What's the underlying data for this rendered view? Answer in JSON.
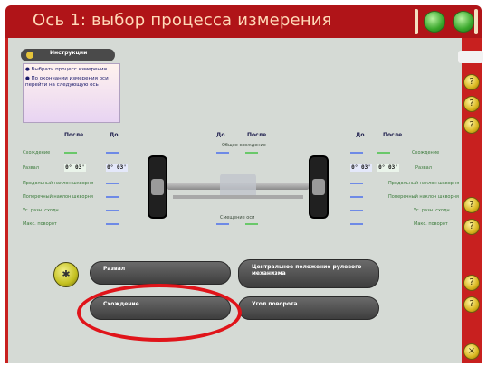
{
  "title": "Ось 1: выбор процесса измерения",
  "instructions": {
    "header": "Инструкции",
    "lines": [
      "● Выбрать процесс измерения",
      "● По окончании измерения оси перейти на следующую ось"
    ]
  },
  "columns": {
    "left_after": "После",
    "left_before": "До",
    "center_before": "До",
    "center_after": "После",
    "right_before": "До",
    "right_after": "После"
  },
  "rows_left": [
    "Схождение",
    "Развал",
    "Продольный наклон шкворня",
    "Поперечный наклон шкворня",
    "Уг. разн. сходн.",
    "Макс. поворот"
  ],
  "rows_right": [
    "Схождение",
    "Развал",
    "Продольный наклон шкворня",
    "Поперечный наклон шкворня",
    "Уг. разн. сходн.",
    "Макс. поворот"
  ],
  "center_labels": {
    "top": "Общее схождение",
    "bottom": "Смещение оси"
  },
  "values": {
    "left_camber_after": "0° 03'",
    "left_camber_before": "0° 03'",
    "right_camber_before": "0° 03'",
    "right_camber_after": "0° 03'"
  },
  "buttons": {
    "camber": "Развал",
    "center_steering": "Центральное положение рулевого механизма",
    "toe": "Схождение",
    "turn_angle": "Угол поворота"
  },
  "side_buttons": [
    "?",
    "?",
    "?",
    "?",
    "?",
    "?",
    "?",
    "×"
  ],
  "colors": {
    "title_bar": "#b01418",
    "side_panel": "#c8201f",
    "background": "#d5dad5",
    "highlight": "#e0141a"
  },
  "icons": {
    "title_orb_1": "green-orb-icon",
    "title_orb_2": "green-orb-icon",
    "truck": "truck-icon",
    "process": "process-icon"
  }
}
